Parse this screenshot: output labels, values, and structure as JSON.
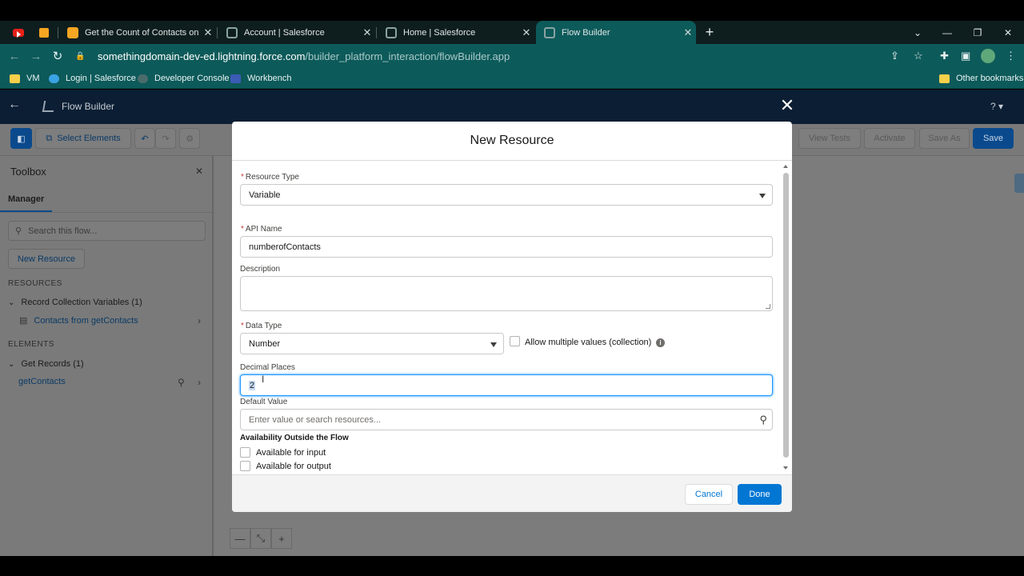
{
  "browser": {
    "tabs": [
      {
        "label": "Get the Count of Contacts on Ac"
      },
      {
        "label": "Account | Salesforce"
      },
      {
        "label": "Home | Salesforce"
      },
      {
        "label": "Flow Builder"
      }
    ],
    "new_tab": "+",
    "url_domain": "somethingdomain-dev-ed.lightning.force.com",
    "url_path": "/builder_platform_interaction/flowBuilder.app",
    "bookmarks": [
      {
        "label": "VM"
      },
      {
        "label": "Login | Salesforce"
      },
      {
        "label": "Developer Console"
      },
      {
        "label": "Workbench"
      }
    ],
    "other_bookmarks": "Other bookmarks"
  },
  "app": {
    "title": "Flow Builder",
    "help": "?",
    "toolbar": {
      "select_elements": "Select Elements",
      "view_tests": "View Tests",
      "activate": "Activate",
      "save_as": "Save As",
      "save": "Save"
    },
    "toolbox": {
      "title": "Toolbox",
      "tab_manager": "Manager",
      "search_placeholder": "Search this flow...",
      "new_resource": "New Resource",
      "resources_heading": "RESOURCES",
      "record_collection_group": "Record Collection Variables (1)",
      "record_collection_item": "Contacts from getContacts",
      "elements_heading": "ELEMENTS",
      "get_records_group": "Get Records (1)",
      "get_records_item": "getContacts"
    },
    "zoom": {
      "minus": "—",
      "fit": "⤡",
      "plus": "+"
    }
  },
  "modal": {
    "title": "New Resource",
    "resource_type": {
      "label": "Resource Type",
      "value": "Variable"
    },
    "api_name": {
      "label": "API Name",
      "value": "numberofContacts"
    },
    "description": {
      "label": "Description",
      "value": ""
    },
    "data_type": {
      "label": "Data Type",
      "value": "Number"
    },
    "allow_multiple": {
      "label": "Allow multiple values (collection)"
    },
    "decimal_places": {
      "label": "Decimal Places",
      "value": "2"
    },
    "default_value": {
      "label": "Default Value",
      "placeholder": "Enter value or search resources..."
    },
    "availability": {
      "heading": "Availability Outside the Flow",
      "input": "Available for input",
      "output": "Available for output"
    },
    "cancel": "Cancel",
    "done": "Done"
  }
}
